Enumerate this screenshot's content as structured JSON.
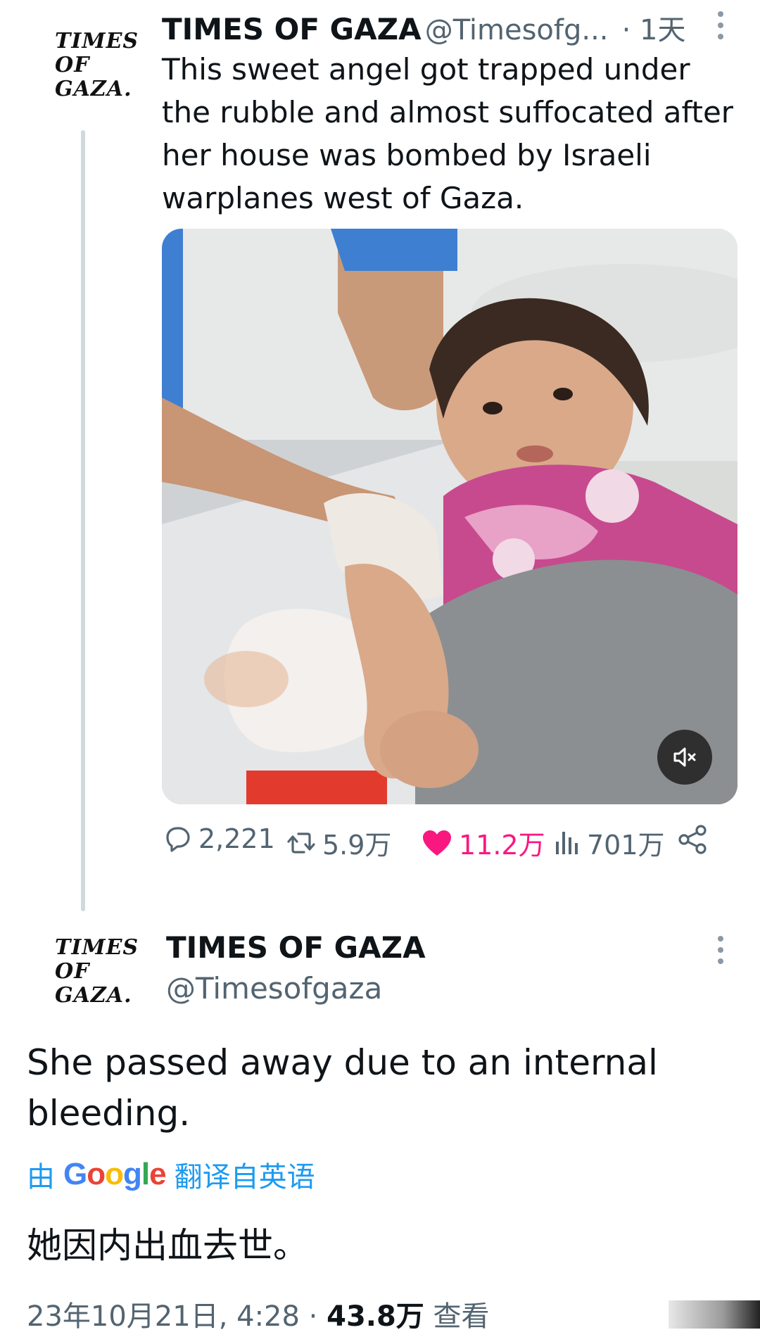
{
  "tweet1": {
    "logo_lines": [
      "TIMES",
      "OF",
      "GAZA."
    ],
    "name": "TIMES OF GAZA",
    "handle": "@Timesofg...",
    "time": "· 1天",
    "text": "This sweet angel got trapped under the rubble and almost suffocated after her house was bombed by Israeli warplanes west of Gaza.",
    "stats": {
      "replies": "2,221",
      "retweets": "5.9万",
      "likes": "11.2万",
      "views": "701万"
    }
  },
  "tweet2": {
    "logo_lines": [
      "TIMES",
      "OF",
      "GAZA."
    ],
    "name": "TIMES OF GAZA",
    "handle": "@Timesofgaza",
    "text": "She passed away due to an internal bleeding.",
    "translate_prefix": "由",
    "translate_brand": "Google",
    "translate_suffix": "翻译自英语",
    "translated_text": "她因内出血去世。",
    "date": "23年10月21日, 4:28 ·",
    "views_count": "43.8万",
    "views_label": "查看"
  },
  "colors": {
    "like": "#f91880",
    "link": "#1d9bf0",
    "muted": "#536471"
  }
}
